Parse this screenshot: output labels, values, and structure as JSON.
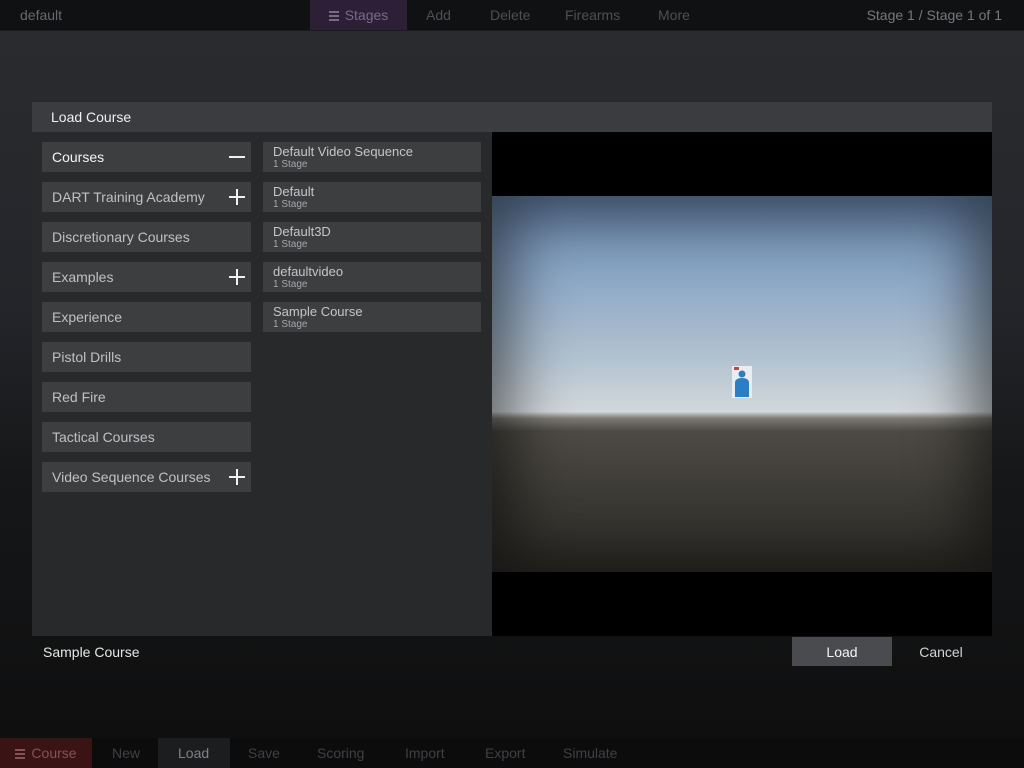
{
  "topbar": {
    "project": "default",
    "stages_label": "Stages",
    "add_label": "Add",
    "delete_label": "Delete",
    "firearms_label": "Firearms",
    "more_label": "More",
    "stage_info": "Stage 1 / Stage 1 of 1"
  },
  "dialog": {
    "title": "Load Course",
    "categories": [
      {
        "label": "Courses",
        "control": "minus"
      },
      {
        "label": "DART Training Academy",
        "control": "plus"
      },
      {
        "label": "Discretionary Courses",
        "control": "none"
      },
      {
        "label": "Examples",
        "control": "plus"
      },
      {
        "label": "Experience",
        "control": "none"
      },
      {
        "label": "Pistol Drills",
        "control": "none"
      },
      {
        "label": "Red Fire",
        "control": "none"
      },
      {
        "label": "Tactical Courses",
        "control": "none"
      },
      {
        "label": "Video Sequence Courses",
        "control": "plus"
      }
    ],
    "courses": [
      {
        "name": "Default Video Sequence",
        "stages": "1 Stage"
      },
      {
        "name": "Default",
        "stages": "1 Stage"
      },
      {
        "name": "Default3D",
        "stages": "1 Stage"
      },
      {
        "name": "defaultvideo",
        "stages": "1 Stage"
      },
      {
        "name": "Sample Course",
        "stages": "1 Stage"
      }
    ],
    "selected_course": "Sample Course",
    "load_label": "Load",
    "cancel_label": "Cancel"
  },
  "bottombar": {
    "course_label": "Course",
    "new_label": "New",
    "load_label": "Load",
    "save_label": "Save",
    "scoring_label": "Scoring",
    "import_label": "Import",
    "export_label": "Export",
    "simulate_label": "Simulate"
  },
  "colors": {
    "accent_purple": "#2c1f36",
    "accent_red": "#3a1414",
    "panel": "#28292b",
    "item": "#3d3e40"
  },
  "icons": [
    "menu-icon",
    "plus-icon",
    "minus-icon",
    "target-silhouette-icon"
  ]
}
